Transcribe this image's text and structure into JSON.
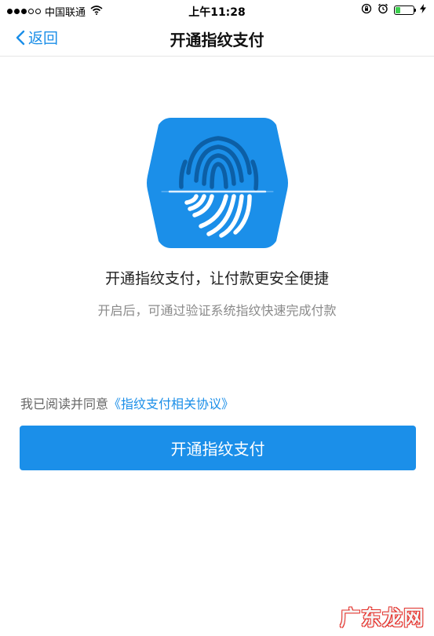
{
  "status_bar": {
    "carrier": "中国联通",
    "time": "上午11:28",
    "signal_dots_filled": 3,
    "signal_dots_total": 5,
    "battery_level": 0.25,
    "battery_color": "#3ccf4e",
    "icons": [
      "wifi-icon",
      "orientation-lock-icon",
      "alarm-icon",
      "charging-icon"
    ]
  },
  "nav": {
    "back_label": "返回",
    "title": "开通指纹支付"
  },
  "hero": {
    "icon": "fingerprint-hexagon-icon",
    "color": "#1b8fe9"
  },
  "content": {
    "headline": "开通指纹支付，让付款更安全便捷",
    "subline": "开启后，可通过验证系统指纹快速完成付款"
  },
  "agreement": {
    "prefix": "我已阅读并同意",
    "link": "《指纹支付相关协议》"
  },
  "primary_button": {
    "label": "开通指纹支付",
    "color": "#1b8fe9"
  },
  "watermark": {
    "text": "广东龙网"
  }
}
